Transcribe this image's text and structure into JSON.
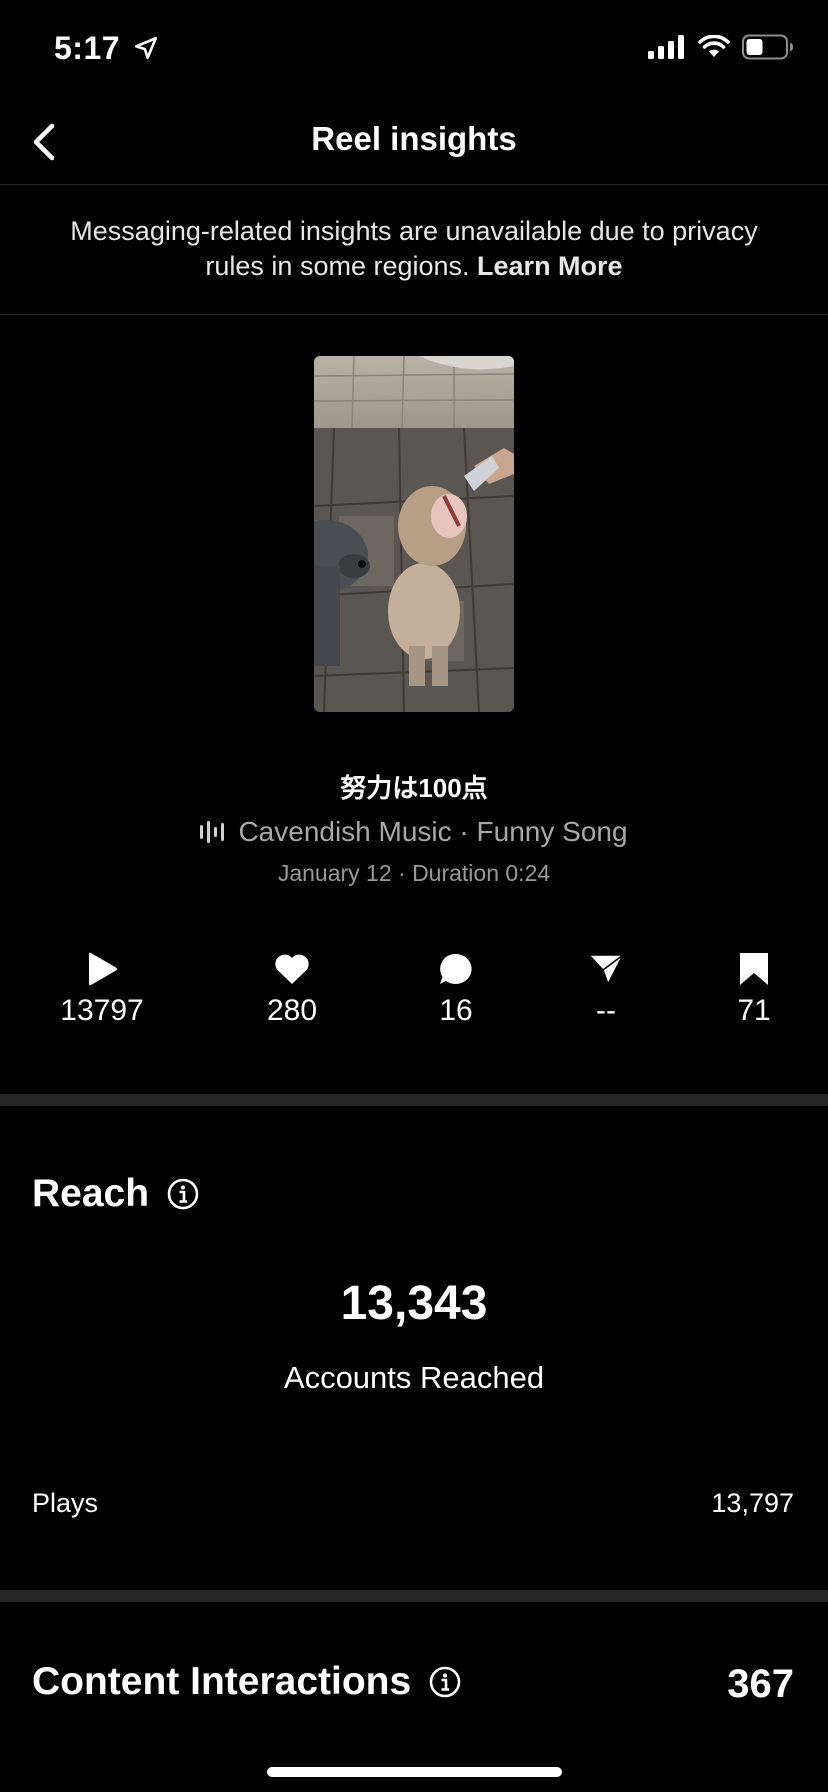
{
  "status_bar": {
    "time": "5:17"
  },
  "header": {
    "title": "Reel insights"
  },
  "notice": {
    "text": "Messaging-related insights are unavailable due to privacy rules in some regions. ",
    "link": "Learn More"
  },
  "reel": {
    "caption": "努力は100点",
    "audio": "Cavendish Music · Funny Song",
    "meta": "January 12 · Duration 0:24"
  },
  "stats": {
    "plays": "13797",
    "likes": "280",
    "comments": "16",
    "shares": "--",
    "saves": "71"
  },
  "reach": {
    "title": "Reach",
    "accounts_reached": "13,343",
    "accounts_reached_label": "Accounts Reached",
    "plays_label": "Plays",
    "plays_value": "13,797"
  },
  "interactions": {
    "title": "Content Interactions",
    "value": "367"
  },
  "icons": {
    "back": "chevron-left-icon",
    "location": "location-arrow-icon",
    "signal": "cellular-signal-icon",
    "wifi": "wifi-icon",
    "battery": "battery-icon",
    "audio": "audio-wave-icon",
    "play": "play-icon",
    "like": "heart-icon",
    "comment": "comment-icon",
    "share": "send-icon",
    "save": "bookmark-icon",
    "info": "info-icon"
  },
  "colors": {
    "background": "#000000",
    "divider": "#262626",
    "secondary_text": "#a8a8a8"
  }
}
